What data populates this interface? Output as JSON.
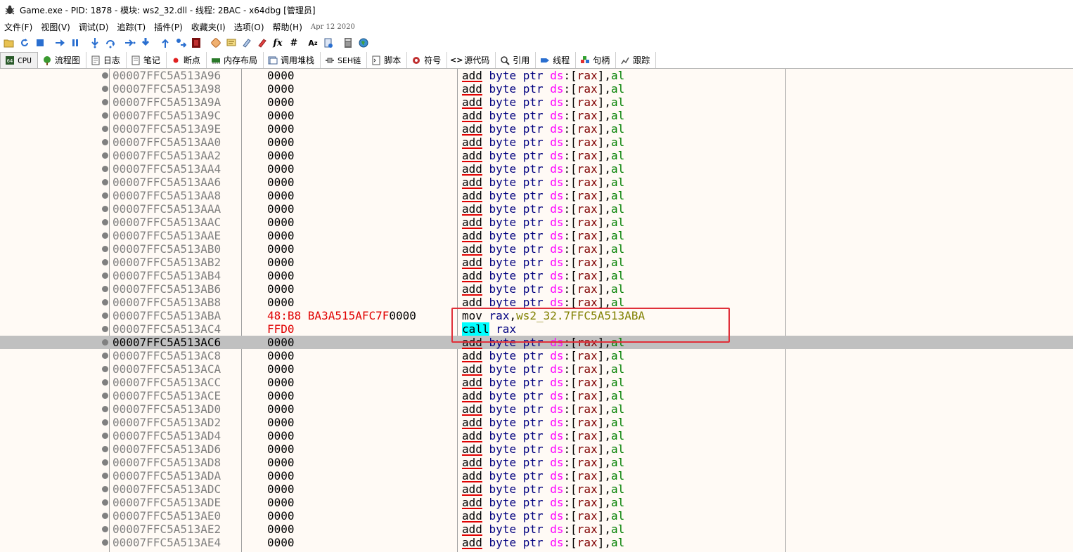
{
  "window": {
    "title": "Game.exe - PID: 1878 - 模块: ws2_32.dll - 线程: 2BAC - x64dbg [管理员]"
  },
  "menu": {
    "items": [
      "文件(F)",
      "视图(V)",
      "调试(D)",
      "追踪(T)",
      "插件(P)",
      "收藏夹(I)",
      "选项(O)",
      "帮助(H)"
    ],
    "date": "Apr 12 2020"
  },
  "toolbar": {
    "icons": [
      "open-icon",
      "restart-icon",
      "stop-icon",
      "run-icon",
      "pause-icon",
      "step-into-icon",
      "step-over-icon",
      "trace-into-icon",
      "trace-over-icon",
      "execute-till-return-icon",
      "run-to-user-code-icon",
      "scylla-icon",
      "patches-icon",
      "comments-icon",
      "labels-icon",
      "bookmarks-icon",
      "functions-icon",
      "fx-icon",
      "hash-icon",
      "strings-icon",
      "help-icon",
      "calculator-icon",
      "globe-icon"
    ]
  },
  "tabs": [
    {
      "label": "CPU",
      "icon": "cpu-icon",
      "active": true
    },
    {
      "label": "流程图",
      "icon": "graph-icon"
    },
    {
      "label": "日志",
      "icon": "log-icon"
    },
    {
      "label": "笔记",
      "icon": "notes-icon"
    },
    {
      "label": "断点",
      "icon": "breakpoint-icon"
    },
    {
      "label": "内存布局",
      "icon": "memory-icon"
    },
    {
      "label": "调用堆栈",
      "icon": "callstack-icon"
    },
    {
      "label": "SEH链",
      "icon": "seh-icon"
    },
    {
      "label": "脚本",
      "icon": "script-icon"
    },
    {
      "label": "符号",
      "icon": "symbols-icon"
    },
    {
      "label": "源代码",
      "icon": "source-icon"
    },
    {
      "label": "引用",
      "icon": "references-icon"
    },
    {
      "label": "线程",
      "icon": "threads-icon"
    },
    {
      "label": "句柄",
      "icon": "handles-icon"
    },
    {
      "label": "跟踪",
      "icon": "trace-icon"
    }
  ],
  "disasm": {
    "add_parts": {
      "mnemonic": "add",
      "size": "byte ptr",
      "seg": "ds",
      "colon": ":",
      "lb": "[",
      "reg": "rax",
      "rb": "]",
      "comma": ",",
      "src": "al"
    },
    "rows": [
      {
        "addr": "00007FFC5A513A96",
        "bytes": "0000",
        "kind": "add"
      },
      {
        "addr": "00007FFC5A513A98",
        "bytes": "0000",
        "kind": "add"
      },
      {
        "addr": "00007FFC5A513A9A",
        "bytes": "0000",
        "kind": "add"
      },
      {
        "addr": "00007FFC5A513A9C",
        "bytes": "0000",
        "kind": "add"
      },
      {
        "addr": "00007FFC5A513A9E",
        "bytes": "0000",
        "kind": "add"
      },
      {
        "addr": "00007FFC5A513AA0",
        "bytes": "0000",
        "kind": "add"
      },
      {
        "addr": "00007FFC5A513AA2",
        "bytes": "0000",
        "kind": "add"
      },
      {
        "addr": "00007FFC5A513AA4",
        "bytes": "0000",
        "kind": "add"
      },
      {
        "addr": "00007FFC5A513AA6",
        "bytes": "0000",
        "kind": "add"
      },
      {
        "addr": "00007FFC5A513AA8",
        "bytes": "0000",
        "kind": "add"
      },
      {
        "addr": "00007FFC5A513AAA",
        "bytes": "0000",
        "kind": "add"
      },
      {
        "addr": "00007FFC5A513AAC",
        "bytes": "0000",
        "kind": "add"
      },
      {
        "addr": "00007FFC5A513AAE",
        "bytes": "0000",
        "kind": "add"
      },
      {
        "addr": "00007FFC5A513AB0",
        "bytes": "0000",
        "kind": "add"
      },
      {
        "addr": "00007FFC5A513AB2",
        "bytes": "0000",
        "kind": "add"
      },
      {
        "addr": "00007FFC5A513AB4",
        "bytes": "0000",
        "kind": "add"
      },
      {
        "addr": "00007FFC5A513AB6",
        "bytes": "0000",
        "kind": "add"
      },
      {
        "addr": "00007FFC5A513AB8",
        "bytes": "0000",
        "kind": "add"
      },
      {
        "addr": "00007FFC5A513ABA",
        "bytes_red": "48:B8 BA3A515AFC7F",
        "bytes_black": "0000",
        "kind": "mov",
        "mnemonic": "mov",
        "dst": "rax",
        "comma": ",",
        "src": "ws2_32.7FFC5A513ABA"
      },
      {
        "addr": "00007FFC5A513AC4",
        "bytes_red": "FFD0",
        "kind": "call",
        "mnemonic": "call",
        "op": "rax"
      },
      {
        "addr": "00007FFC5A513AC6",
        "bytes": "0000",
        "kind": "add",
        "selected": true
      },
      {
        "addr": "00007FFC5A513AC8",
        "bytes": "0000",
        "kind": "add"
      },
      {
        "addr": "00007FFC5A513ACA",
        "bytes": "0000",
        "kind": "add"
      },
      {
        "addr": "00007FFC5A513ACC",
        "bytes": "0000",
        "kind": "add"
      },
      {
        "addr": "00007FFC5A513ACE",
        "bytes": "0000",
        "kind": "add"
      },
      {
        "addr": "00007FFC5A513AD0",
        "bytes": "0000",
        "kind": "add"
      },
      {
        "addr": "00007FFC5A513AD2",
        "bytes": "0000",
        "kind": "add"
      },
      {
        "addr": "00007FFC5A513AD4",
        "bytes": "0000",
        "kind": "add"
      },
      {
        "addr": "00007FFC5A513AD6",
        "bytes": "0000",
        "kind": "add"
      },
      {
        "addr": "00007FFC5A513AD8",
        "bytes": "0000",
        "kind": "add"
      },
      {
        "addr": "00007FFC5A513ADA",
        "bytes": "0000",
        "kind": "add"
      },
      {
        "addr": "00007FFC5A513ADC",
        "bytes": "0000",
        "kind": "add"
      },
      {
        "addr": "00007FFC5A513ADE",
        "bytes": "0000",
        "kind": "add"
      },
      {
        "addr": "00007FFC5A513AE0",
        "bytes": "0000",
        "kind": "add"
      },
      {
        "addr": "00007FFC5A513AE2",
        "bytes": "0000",
        "kind": "add"
      },
      {
        "addr": "00007FFC5A513AE4",
        "bytes": "0000",
        "kind": "add"
      }
    ]
  }
}
